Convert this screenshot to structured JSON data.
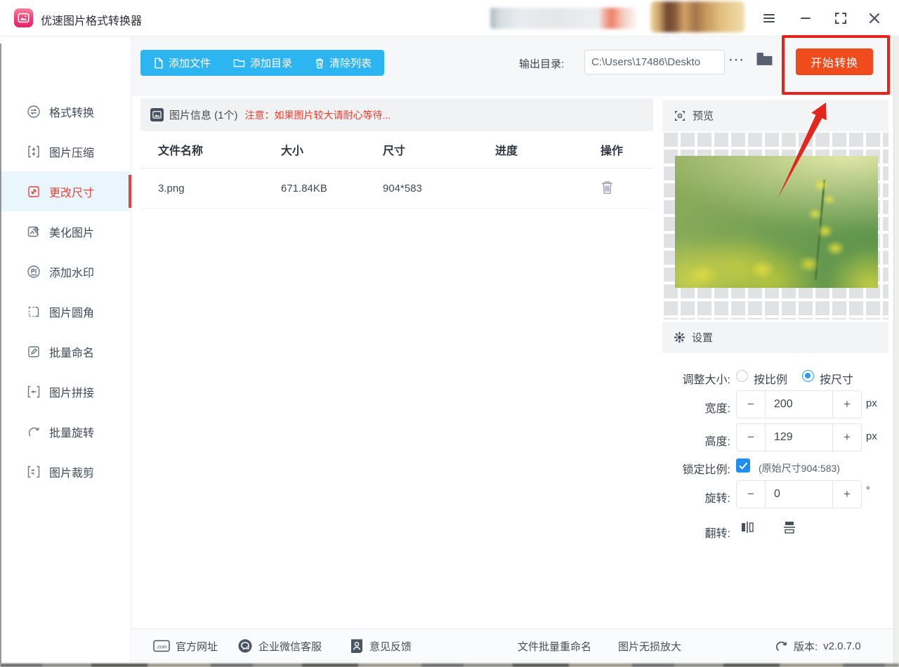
{
  "window": {
    "title": "优速图片格式转换器",
    "controls": {
      "menu": "menu",
      "minimize": "minimize",
      "maximize": "maximize",
      "close": "close"
    }
  },
  "sidebar": {
    "items": [
      {
        "label": "格式转换",
        "active": false
      },
      {
        "label": "图片压缩",
        "active": false
      },
      {
        "label": "更改尺寸",
        "active": true
      },
      {
        "label": "美化图片",
        "active": false
      },
      {
        "label": "添加水印",
        "active": false
      },
      {
        "label": "图片圆角",
        "active": false
      },
      {
        "label": "批量命名",
        "active": false
      },
      {
        "label": "图片拼接",
        "active": false
      },
      {
        "label": "批量旋转",
        "active": false
      },
      {
        "label": "图片裁剪",
        "active": false
      }
    ]
  },
  "toolbar": {
    "add_files": "添加文件",
    "add_dir": "添加目录",
    "clear_list": "清除列表",
    "output_label": "输出目录:",
    "output_path": "C:\\Users\\17486\\Deskto",
    "more": "···",
    "start": "开始转换"
  },
  "table": {
    "info_title": "图片信息 (1个)",
    "info_note": "注意：如果图片较大请耐心等待...",
    "columns": [
      "文件名称",
      "大小",
      "尺寸",
      "进度",
      "操作"
    ],
    "rows": [
      {
        "name": "3.png",
        "size": "671.84KB",
        "dims": "904*583",
        "progress_percent": 0
      }
    ]
  },
  "preview": {
    "title": "预览"
  },
  "settings": {
    "title": "设置",
    "resize_label": "调整大小:",
    "radio_ratio": "按比例",
    "radio_size": "按尺寸",
    "resize_mode": "按尺寸",
    "minus": "−",
    "plus": "+",
    "width_label": "宽度:",
    "width_value": "200",
    "width_unit": "px",
    "height_label": "高度:",
    "height_value": "129",
    "height_unit": "px",
    "lock_label": "锁定比例:",
    "lock_enabled": true,
    "lock_note": "(原始尺寸904:583)",
    "rotate_label": "旋转:",
    "rotate_value": "0",
    "rotate_unit": "°",
    "flip_label": "翻转:"
  },
  "footer": {
    "official_site": "官方网址",
    "wechat_support": "企业微信客服",
    "feedback": "意见反馈",
    "batch_rename": "文件批量重命名",
    "lossless_upscale": "图片无损放大",
    "version_label": "版本:",
    "version": "v2.0.7.0"
  },
  "colors": {
    "accent_blue": "#2db5f2",
    "accent_orange": "#f04b1d",
    "annotation_red": "#e2261b",
    "active_red": "#e5413b",
    "note_red": "#f43b2c",
    "selected_bg": "#e9f6fe"
  }
}
